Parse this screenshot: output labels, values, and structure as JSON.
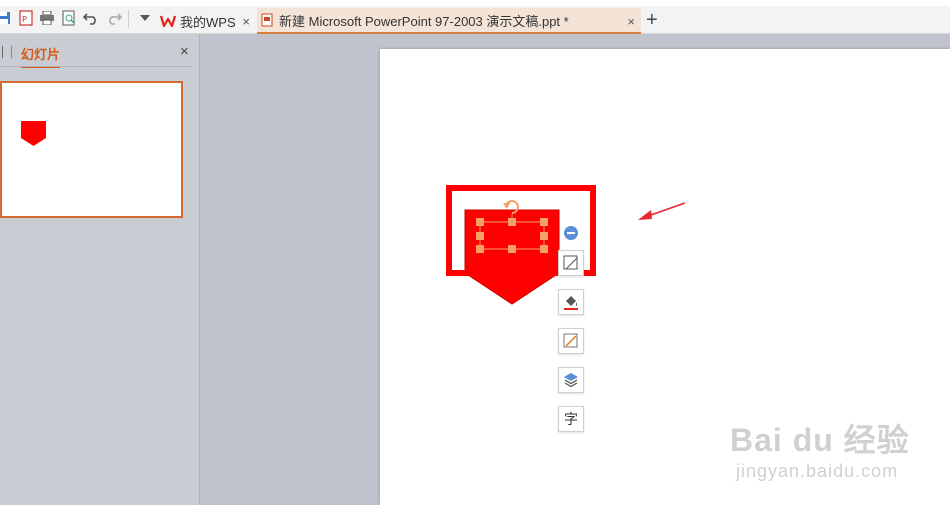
{
  "tabs": [
    {
      "label": "我的WPS",
      "close": "×",
      "accent": "#e2231a"
    },
    {
      "label": "新建 Microsoft PowerPoint 97-2003 演示文稿.ppt *",
      "close": "×",
      "accent": "#c84b1f"
    }
  ],
  "new_tab": "+",
  "quick_access_icons": [
    "save-icon",
    "export-pdf-icon",
    "print-icon",
    "print-preview-icon",
    "undo-icon",
    "redo-icon",
    "customize-dropdown-icon"
  ],
  "left_panel": {
    "title": "幻灯片",
    "close": "×"
  },
  "slide": {
    "shape": {
      "type": "pentagon-arrow-down",
      "fill": "#ff0000"
    },
    "annotation_color": "#ff0000",
    "selection_handle_color": "#f5a065"
  },
  "float_toolbar_icons": [
    "collapse-minus-icon",
    "shape-style-icon",
    "fill-icon",
    "outline-icon",
    "arrange-layers-icon",
    "text-wrap-icon"
  ],
  "float_toolbar": {
    "text_glyph": "字"
  },
  "watermark": {
    "main": "Bai du 经验",
    "sub": "jingyan.baidu.com"
  }
}
